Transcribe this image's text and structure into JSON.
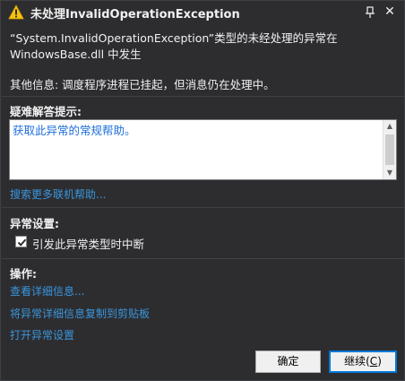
{
  "dialog": {
    "title": "未处理InvalidOperationException",
    "description_line1": "“System.InvalidOperationException”类型的未经处理的异常在",
    "description_line2": "WindowsBase.dll 中发生",
    "additional_info": "其他信息: 调度程序进程已挂起，但消息仍在处理中。"
  },
  "troubleshooting": {
    "title": "疑难解答提示:",
    "tip_link": "获取此异常的常规帮助。",
    "search_link": "搜索更多联机帮助..."
  },
  "exception_settings": {
    "title": "异常设置:",
    "checkbox_label": "引发此异常类型时中断",
    "checked": true
  },
  "actions": {
    "title": "操作:",
    "view_details": "查看详细信息...",
    "copy_details": "将异常详细信息复制到剪贴板",
    "open_settings": "打开异常设置"
  },
  "buttons": {
    "ok": "确定",
    "continue_prefix": "继续(",
    "continue_key": "C",
    "continue_suffix": ")"
  },
  "icons": {
    "warning": "warning-icon",
    "pin": "pin-icon",
    "close": "close-icon"
  },
  "colors": {
    "background": "#2d2d30",
    "link": "#3a96dd",
    "warning": "#f5c211"
  }
}
